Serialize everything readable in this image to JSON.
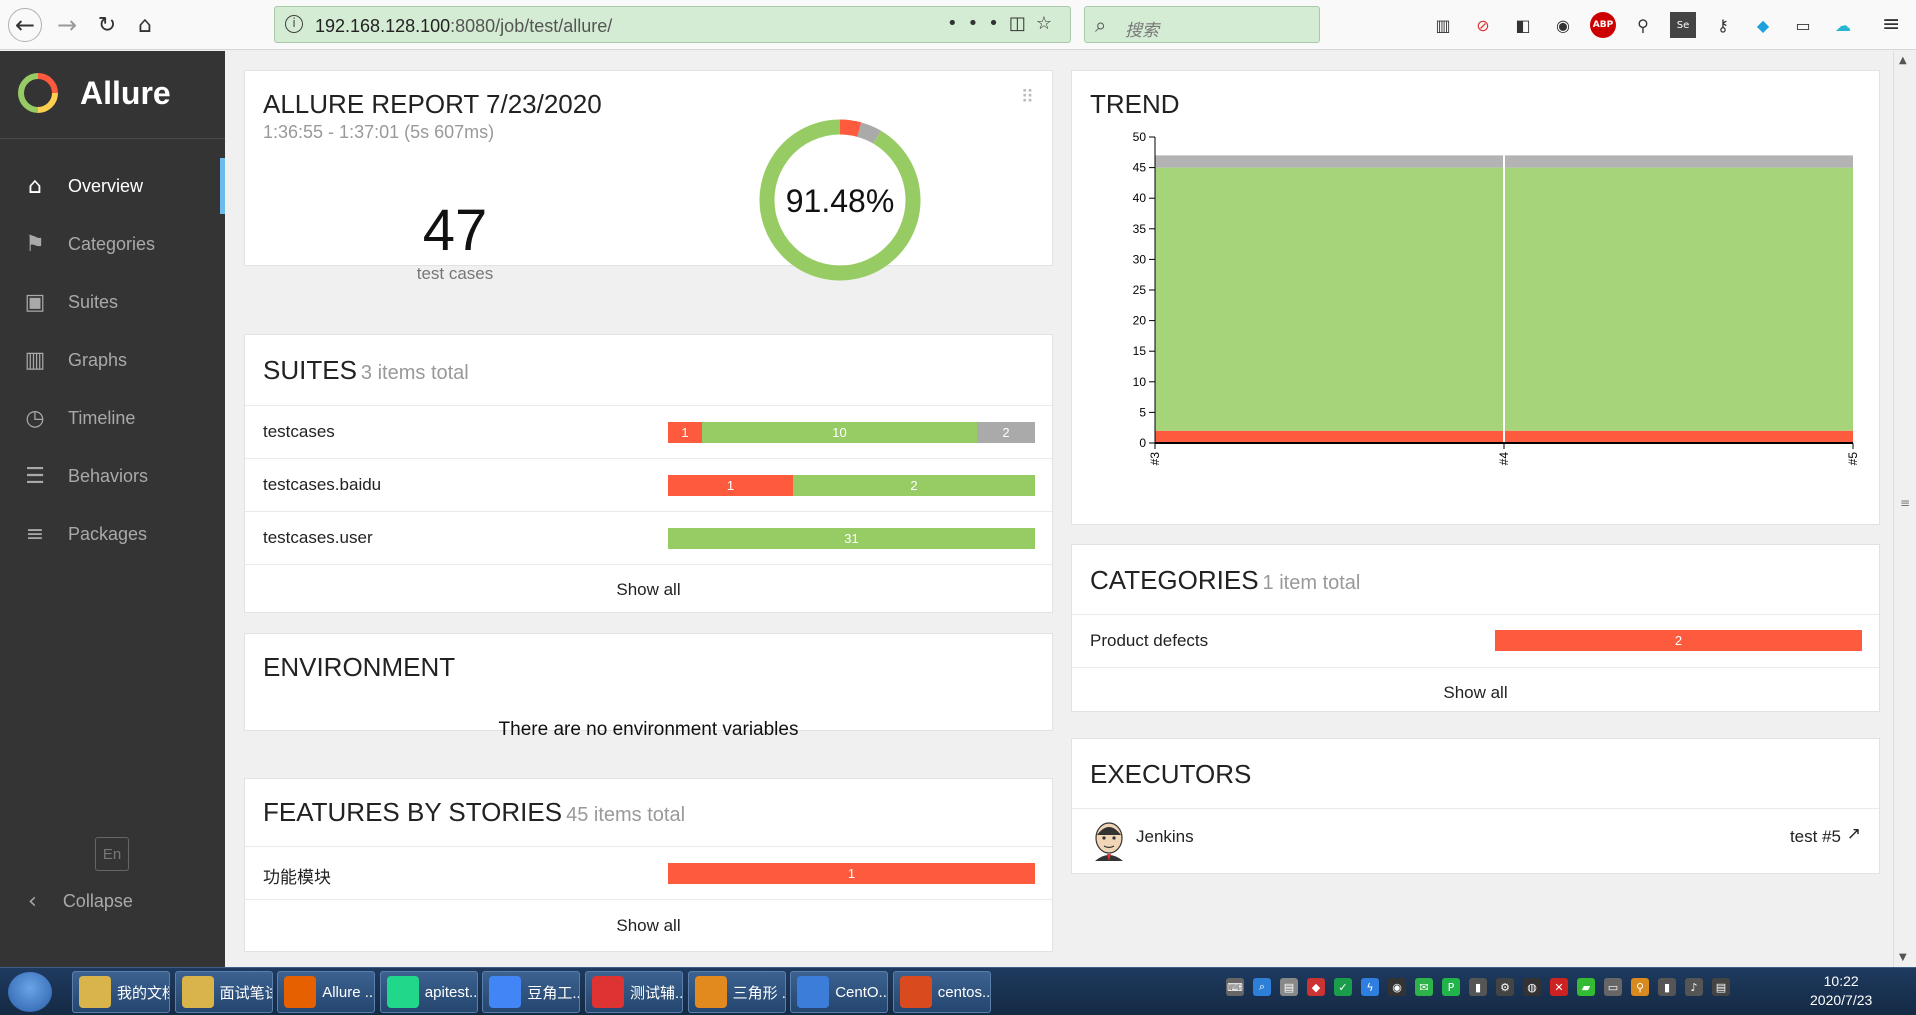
{
  "browser": {
    "url_host": "192.168.128.100",
    "url_rest": ":8080/job/test/allure/",
    "search_placeholder": "搜索",
    "menu_dots": "•••"
  },
  "sidebar": {
    "brand": "Allure",
    "items": [
      {
        "label": "Overview",
        "icon": "home-icon",
        "active": true
      },
      {
        "label": "Categories",
        "icon": "flag-icon",
        "active": false
      },
      {
        "label": "Suites",
        "icon": "briefcase-icon",
        "active": false
      },
      {
        "label": "Graphs",
        "icon": "bar-chart-icon",
        "active": false
      },
      {
        "label": "Timeline",
        "icon": "clock-icon",
        "active": false
      },
      {
        "label": "Behaviors",
        "icon": "list-icon",
        "active": false
      },
      {
        "label": "Packages",
        "icon": "align-left-icon",
        "active": false
      }
    ],
    "lang": "En",
    "collapse": "Collapse"
  },
  "summary": {
    "title": "ALLURE REPORT 7/23/2020",
    "duration": "1:36:55 - 1:37:01 (5s 607ms)",
    "count": "47",
    "count_label": "test cases",
    "percent": "91.48%",
    "donut": {
      "failed": 2,
      "skipped": 2,
      "passed": 43
    }
  },
  "suites": {
    "title": "SUITES",
    "subtitle": "3 items total",
    "rows": [
      {
        "name": "testcases",
        "failed": 1,
        "passed": 10,
        "skipped": 2
      },
      {
        "name": "testcases.baidu",
        "failed": 1,
        "passed": 2,
        "skipped": 0
      },
      {
        "name": "testcases.user",
        "failed": 0,
        "passed": 31,
        "skipped": 0
      }
    ],
    "show_all": "Show all"
  },
  "environment": {
    "title": "ENVIRONMENT",
    "empty": "There are no environment variables"
  },
  "features": {
    "title": "FEATURES BY STORIES",
    "subtitle": "45 items total",
    "rows": [
      {
        "name": "功能模块",
        "failed": 1,
        "passed": 0,
        "skipped": 0
      }
    ],
    "show_all": "Show all"
  },
  "trend": {
    "title": "TREND"
  },
  "chart_data": {
    "type": "area",
    "title": "TREND",
    "categories": [
      "#3",
      "#4",
      "#5"
    ],
    "series": [
      {
        "name": "failed",
        "values": [
          2,
          2,
          2
        ]
      },
      {
        "name": "passed",
        "values": [
          43,
          43,
          43
        ]
      },
      {
        "name": "skipped",
        "values": [
          2,
          2,
          2
        ]
      }
    ],
    "ylim": [
      0,
      50
    ],
    "yticks": [
      "0",
      "5",
      "10",
      "15",
      "20",
      "25",
      "30",
      "35",
      "40",
      "45",
      "50"
    ],
    "colors": {
      "failed": "#fd5a3e",
      "passed": "#a6d47b",
      "skipped": "#b3b3b3"
    }
  },
  "categories": {
    "title": "CATEGORIES",
    "subtitle": "1 item total",
    "rows": [
      {
        "name": "Product defects",
        "failed": 2,
        "passed": 0,
        "skipped": 0
      }
    ],
    "show_all": "Show all"
  },
  "executors": {
    "title": "EXECUTORS",
    "name": "Jenkins",
    "build": "test #5"
  },
  "taskbar": {
    "items": [
      {
        "label": "我的文档",
        "color": "#d9b44a"
      },
      {
        "label": "面试笔试",
        "color": "#d9b44a"
      },
      {
        "label": "Allure ...",
        "color": "#e66000"
      },
      {
        "label": "apitest...",
        "color": "#21d789"
      },
      {
        "label": "豆角工...",
        "color": "#4285f4"
      },
      {
        "label": "测试辅...",
        "color": "#d33"
      },
      {
        "label": "三角形 ...",
        "color": "#e38a1e"
      },
      {
        "label": "CentO...",
        "color": "#3b7dd8"
      },
      {
        "label": "centos...",
        "color": "#d94a1e"
      }
    ],
    "time": "10:22",
    "date": "2020/7/23"
  },
  "colors": {
    "failed": "#fd5a3e",
    "passed": "#97cc64",
    "skipped": "#aaaaaa",
    "sidebar_bg": "#343434",
    "accent": "#6dbbea"
  }
}
